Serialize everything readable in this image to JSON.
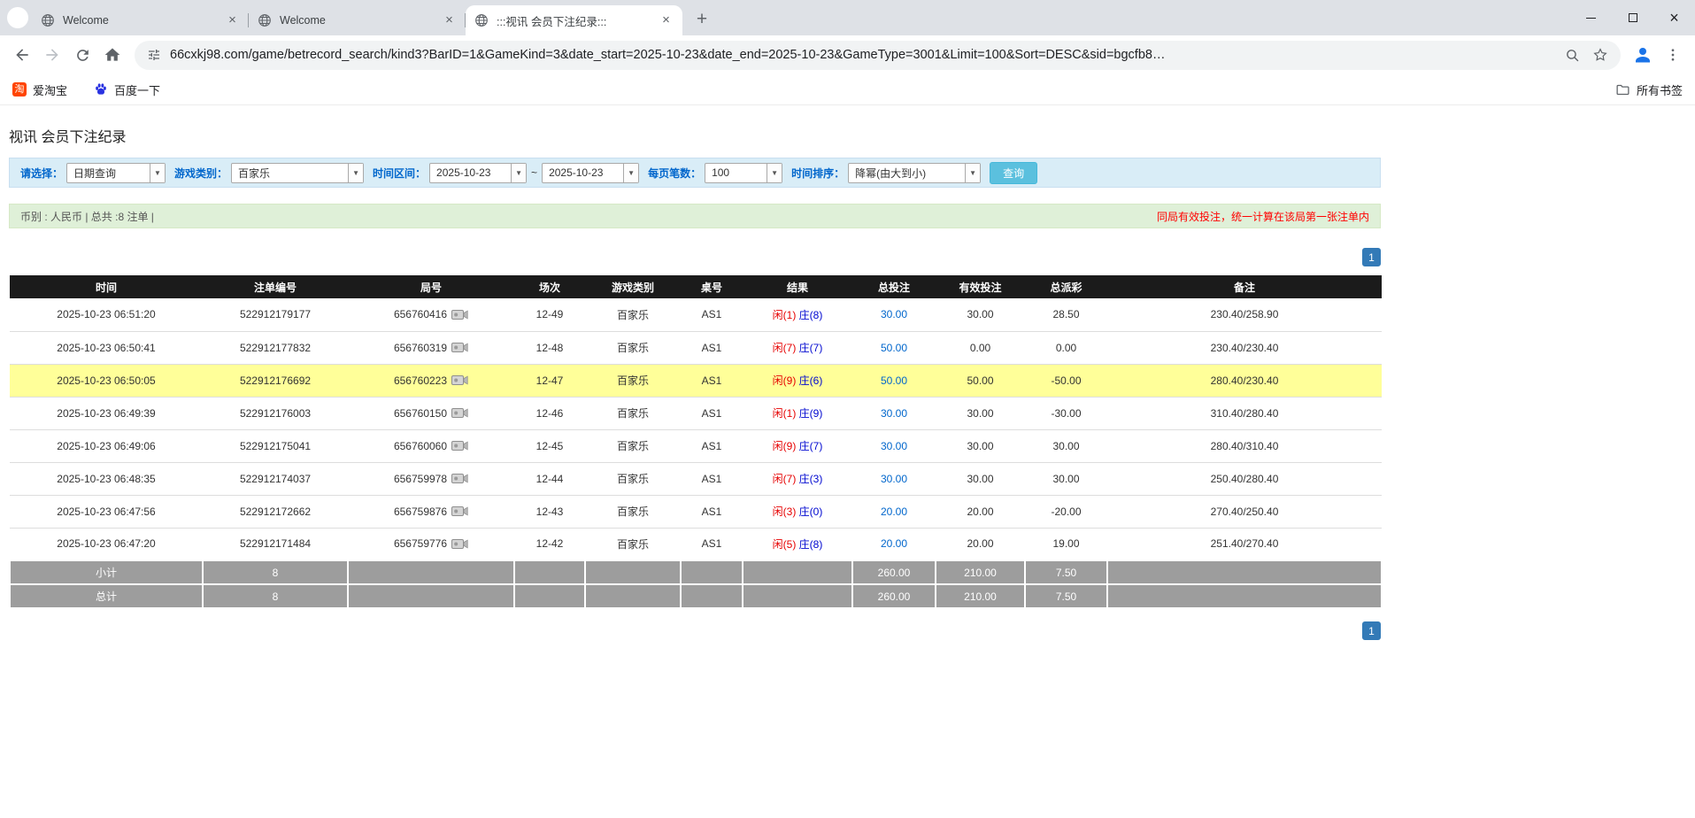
{
  "browser": {
    "tabs": [
      {
        "title": "Welcome"
      },
      {
        "title": "Welcome"
      },
      {
        "title": ":::视讯 会员下注纪录:::"
      }
    ],
    "new_tab_label": "+",
    "url": "66cxkj98.com/game/betrecord_search/kind3?BarID=1&GameKind=3&date_start=2025-10-23&date_end=2025-10-23&GameType=3001&Limit=100&Sort=DESC&sid=bgcfb8…",
    "bookmarks": [
      {
        "label": "爱淘宝",
        "icon": "taobao-icon",
        "icon_glyph": "淘"
      },
      {
        "label": "百度一下",
        "icon": "baidu-paw-icon"
      }
    ],
    "all_bookmarks_label": "所有书签"
  },
  "page": {
    "title": "视讯 会员下注纪录",
    "filters": {
      "select_label": "请选择：",
      "select_value": "日期查询",
      "game_type_label": "游戏类别：",
      "game_type_value": "百家乐",
      "date_range_label": "时间区间：",
      "date_start": "2025-10-23",
      "date_separator": "~",
      "date_end": "2025-10-23",
      "page_size_label": "每页笔数：",
      "page_size_value": "100",
      "sort_label": "时间排序：",
      "sort_value": "降幂(由大到小)",
      "search_button": "查询"
    },
    "summary": {
      "left": "币别 : 人民币 | 总共 :8 注单 |",
      "right": "同局有效投注，统一计算在该局第一张注单内"
    },
    "pagination": "1",
    "table": {
      "headers": [
        "时间",
        "注单编号",
        "局号",
        "场次",
        "游戏类别",
        "桌号",
        "结果",
        "总投注",
        "有效投注",
        "总派彩",
        "备注"
      ],
      "rows": [
        {
          "time": "2025-10-23 06:51:20",
          "bet_id": "522912179177",
          "round": "656760416",
          "session": "12-49",
          "game": "百家乐",
          "table_no": "AS1",
          "player": "闲(1)",
          "banker": "庄(8)",
          "total_bet": "30.00",
          "valid_bet": "30.00",
          "payout": "28.50",
          "remark": "230.40/258.90",
          "highlight": false
        },
        {
          "time": "2025-10-23 06:50:41",
          "bet_id": "522912177832",
          "round": "656760319",
          "session": "12-48",
          "game": "百家乐",
          "table_no": "AS1",
          "player": "闲(7)",
          "banker": "庄(7)",
          "total_bet": "50.00",
          "valid_bet": "0.00",
          "payout": "0.00",
          "remark": "230.40/230.40",
          "highlight": false
        },
        {
          "time": "2025-10-23 06:50:05",
          "bet_id": "522912176692",
          "round": "656760223",
          "session": "12-47",
          "game": "百家乐",
          "table_no": "AS1",
          "player": "闲(9)",
          "banker": "庄(6)",
          "total_bet": "50.00",
          "valid_bet": "50.00",
          "payout": "-50.00",
          "remark": "280.40/230.40",
          "highlight": true
        },
        {
          "time": "2025-10-23 06:49:39",
          "bet_id": "522912176003",
          "round": "656760150",
          "session": "12-46",
          "game": "百家乐",
          "table_no": "AS1",
          "player": "闲(1)",
          "banker": "庄(9)",
          "total_bet": "30.00",
          "valid_bet": "30.00",
          "payout": "-30.00",
          "remark": "310.40/280.40",
          "highlight": false
        },
        {
          "time": "2025-10-23 06:49:06",
          "bet_id": "522912175041",
          "round": "656760060",
          "session": "12-45",
          "game": "百家乐",
          "table_no": "AS1",
          "player": "闲(9)",
          "banker": "庄(7)",
          "total_bet": "30.00",
          "valid_bet": "30.00",
          "payout": "30.00",
          "remark": "280.40/310.40",
          "highlight": false
        },
        {
          "time": "2025-10-23 06:48:35",
          "bet_id": "522912174037",
          "round": "656759978",
          "session": "12-44",
          "game": "百家乐",
          "table_no": "AS1",
          "player": "闲(7)",
          "banker": "庄(3)",
          "total_bet": "30.00",
          "valid_bet": "30.00",
          "payout": "30.00",
          "remark": "250.40/280.40",
          "highlight": false
        },
        {
          "time": "2025-10-23 06:47:56",
          "bet_id": "522912172662",
          "round": "656759876",
          "session": "12-43",
          "game": "百家乐",
          "table_no": "AS1",
          "player": "闲(3)",
          "banker": "庄(0)",
          "total_bet": "20.00",
          "valid_bet": "20.00",
          "payout": "-20.00",
          "remark": "270.40/250.40",
          "highlight": false
        },
        {
          "time": "2025-10-23 06:47:20",
          "bet_id": "522912171484",
          "round": "656759776",
          "session": "12-42",
          "game": "百家乐",
          "table_no": "AS1",
          "player": "闲(5)",
          "banker": "庄(8)",
          "total_bet": "20.00",
          "valid_bet": "20.00",
          "payout": "19.00",
          "remark": "251.40/270.40",
          "highlight": false
        }
      ],
      "subtotal": {
        "label": "小计",
        "count": "8",
        "total_bet": "260.00",
        "valid_bet": "210.00",
        "payout": "7.50"
      },
      "total": {
        "label": "总计",
        "count": "8",
        "total_bet": "260.00",
        "valid_bet": "210.00",
        "payout": "7.50"
      }
    }
  },
  "icons": {
    "tab_favicon": "globe-icon",
    "round_media": "video-camera-icon",
    "address_left": "tune-icon",
    "address_right": [
      "zoom-icon",
      "star-icon"
    ],
    "toolbar": [
      "back-icon",
      "forward-icon",
      "reload-icon",
      "home-icon",
      "profile-icon",
      "menu-dots-icon"
    ],
    "bookmarks_right": "folder-icon"
  },
  "colors": {
    "accent_blue": "#337ab7",
    "filter_bar_bg": "#d9edf7",
    "summary_bar_bg": "#dff0d8",
    "highlight_row": "#ffff99",
    "negative_red": "#ff0000",
    "player_red": "#e60000",
    "banker_blue": "#0008d0",
    "link_blue": "#0066cc",
    "table_header_bg": "#1b1b1b",
    "footer_gray": "#9d9d9d",
    "search_button_bg": "#5bc0de",
    "tab_strip_bg": "#dee1e6"
  }
}
